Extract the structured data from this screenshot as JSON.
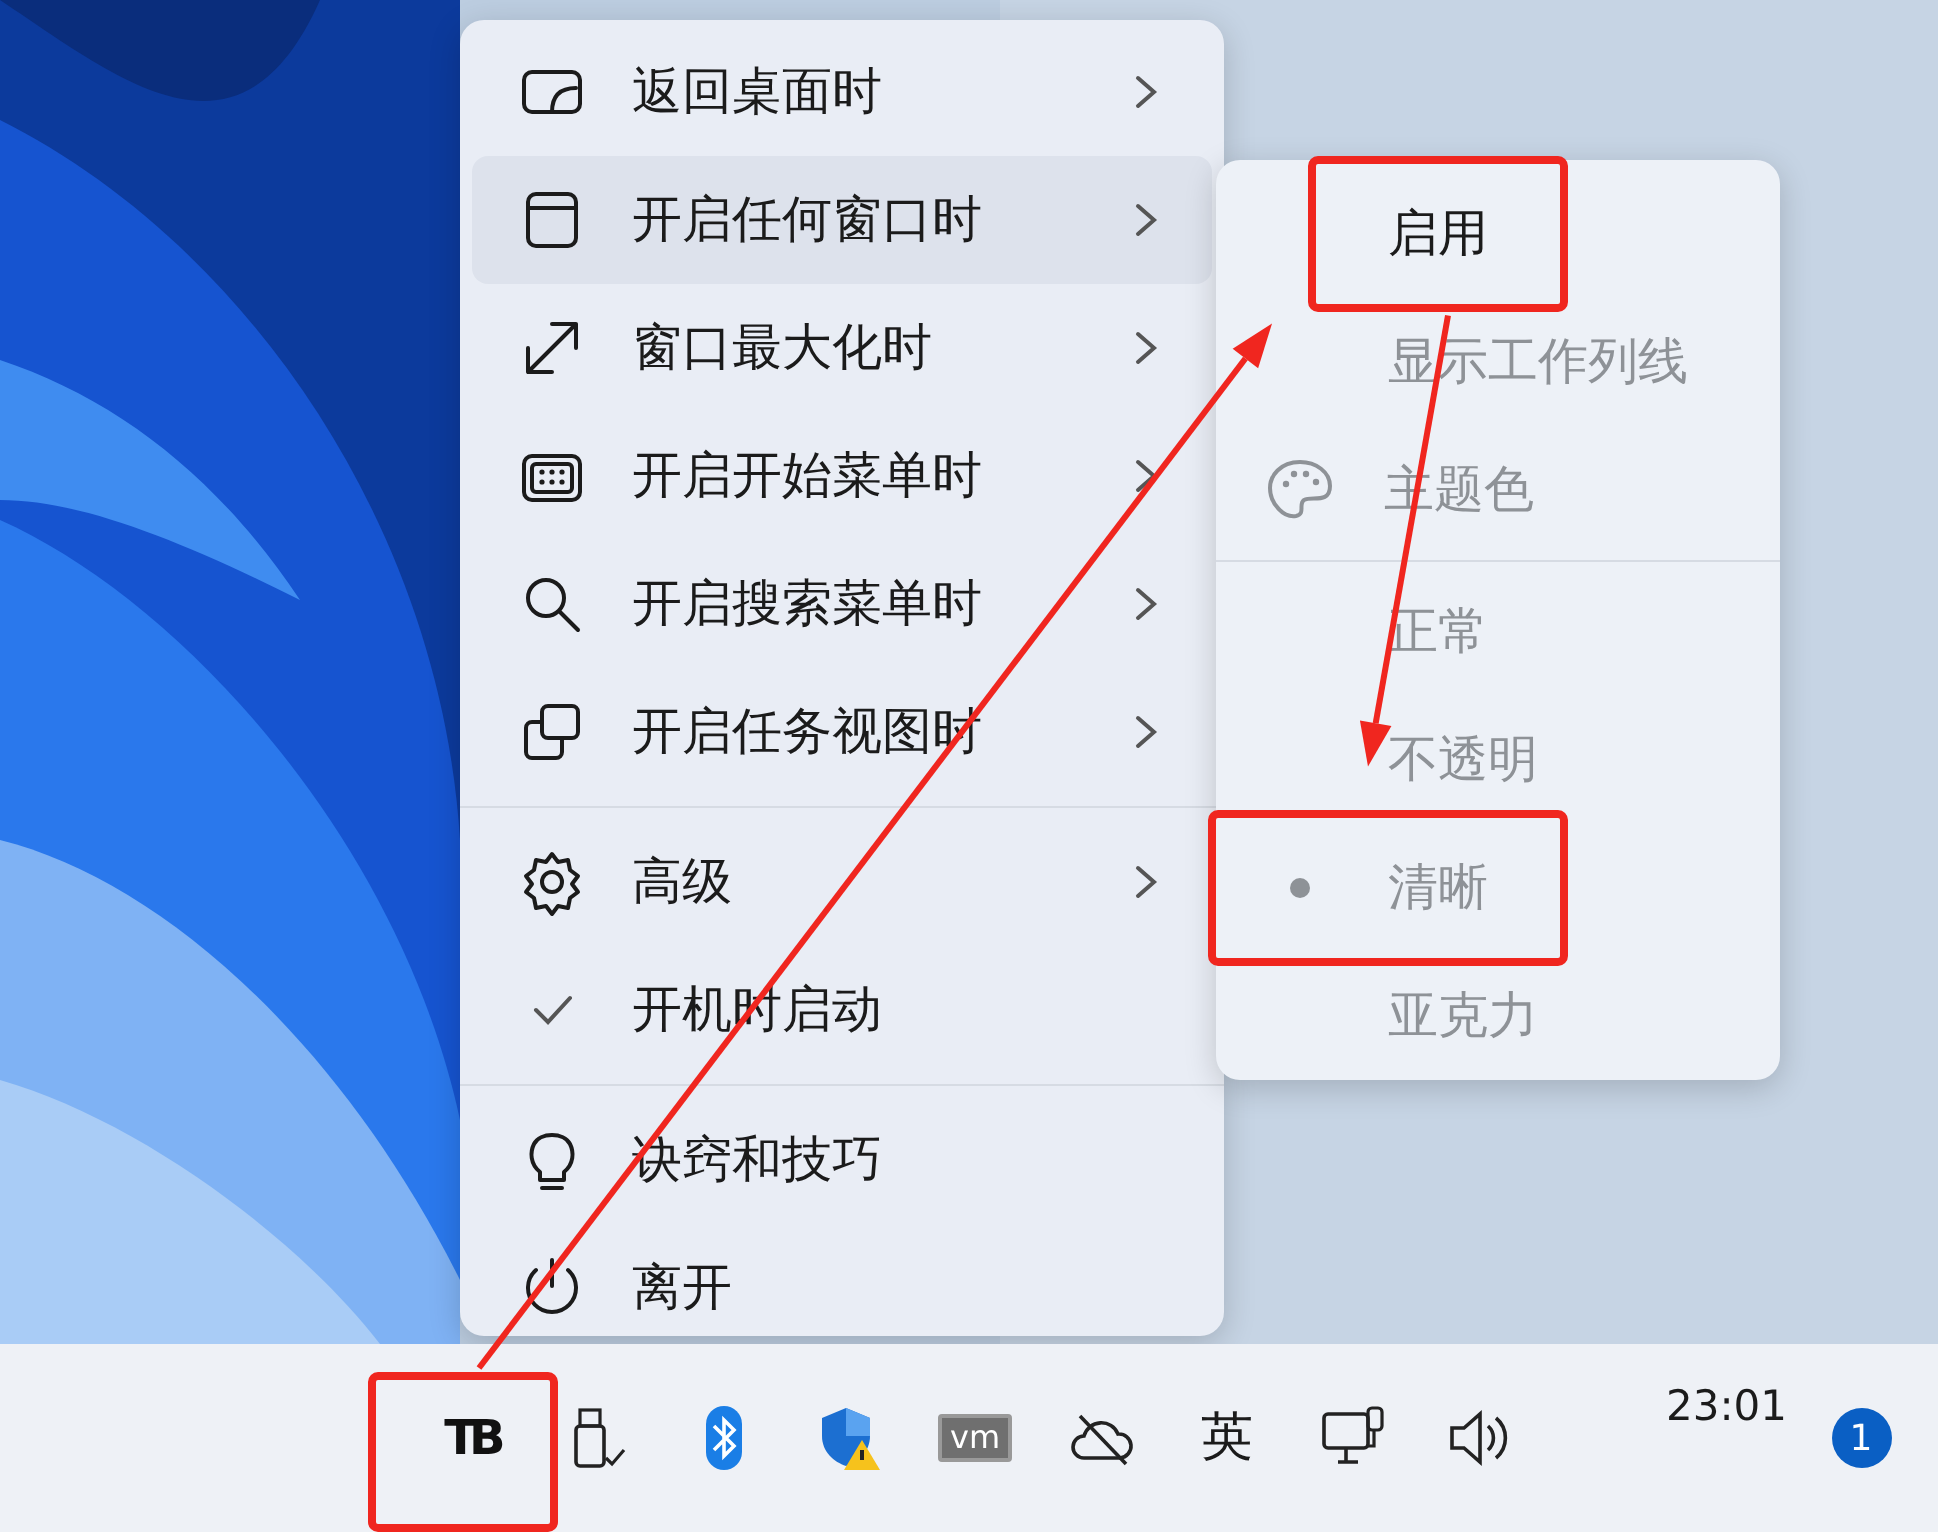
{
  "main_menu": {
    "items": [
      {
        "kind": "desktop",
        "label": "返回桌面时",
        "submenu": true,
        "selected": false
      },
      {
        "kind": "window",
        "label": "开启任何窗口时",
        "submenu": true,
        "selected": true
      },
      {
        "kind": "maximize",
        "label": "窗口最大化时",
        "submenu": true,
        "selected": false
      },
      {
        "kind": "start",
        "label": "开启开始菜单时",
        "submenu": true,
        "selected": false
      },
      {
        "kind": "search",
        "label": "开启搜索菜单时",
        "submenu": true,
        "selected": false
      },
      {
        "kind": "taskview",
        "label": "开启任务视图时",
        "submenu": true,
        "selected": false
      },
      {
        "kind": "separator"
      },
      {
        "kind": "gear",
        "label": "高级",
        "submenu": true,
        "selected": false
      },
      {
        "kind": "check",
        "label": "开机时启动",
        "checked": true,
        "selected": false
      },
      {
        "kind": "separator"
      },
      {
        "kind": "bulb",
        "label": "诀窍和技巧",
        "submenu": false,
        "selected": false
      },
      {
        "kind": "power",
        "label": "离开",
        "submenu": false,
        "selected": false
      }
    ]
  },
  "sub_menu": {
    "items": [
      {
        "kind": "check",
        "label": "启用",
        "checked": false,
        "disabled": false,
        "highlighted": true
      },
      {
        "kind": "check",
        "label": "显示工作列线",
        "checked": false,
        "disabled": true,
        "highlighted": false
      },
      {
        "kind": "palette",
        "label": "主题色",
        "disabled": true,
        "highlighted": false
      },
      {
        "kind": "separator"
      },
      {
        "kind": "radio",
        "label": "正常",
        "selected": false,
        "disabled": true,
        "highlighted": false
      },
      {
        "kind": "radio",
        "label": "不透明",
        "selected": false,
        "disabled": true,
        "highlighted": false
      },
      {
        "kind": "radio",
        "label": "清晰",
        "selected": true,
        "disabled": true,
        "highlighted": true
      },
      {
        "kind": "radio",
        "label": "亚克力",
        "selected": false,
        "disabled": true,
        "highlighted": false
      }
    ]
  },
  "taskbar": {
    "tray": [
      {
        "kind": "tb",
        "label": "TB",
        "highlighted": true
      },
      {
        "kind": "usb",
        "highlighted": false
      },
      {
        "kind": "bluetooth",
        "highlighted": false
      },
      {
        "kind": "shield",
        "highlighted": false
      },
      {
        "kind": "vm",
        "label": "vm",
        "highlighted": false
      },
      {
        "kind": "cloud",
        "highlighted": false
      },
      {
        "kind": "ime",
        "label": "英",
        "highlighted": false
      },
      {
        "kind": "network",
        "highlighted": false
      },
      {
        "kind": "volume",
        "highlighted": false
      }
    ],
    "clock": "23:01",
    "notifications": "1"
  }
}
